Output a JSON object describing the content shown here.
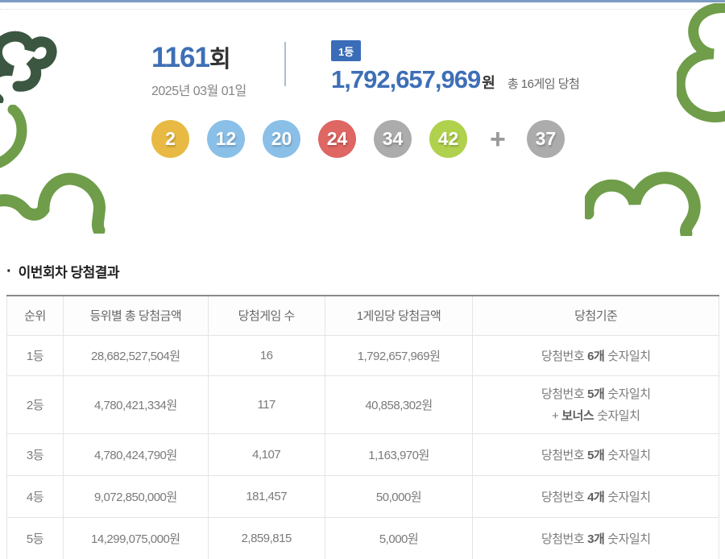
{
  "header": {
    "draw_no": "1161",
    "draw_no_suffix": "회",
    "draw_date": "2025년 03월 01일",
    "rank_badge": "1등",
    "first_prize_amount": "1,792,657,969",
    "won_suffix": "원",
    "total_games": "총 16게임 당첨"
  },
  "balls": {
    "numbers": [
      {
        "value": "2",
        "color": "#e8ba44"
      },
      {
        "value": "12",
        "color": "#8ac0e8"
      },
      {
        "value": "20",
        "color": "#8ac0e8"
      },
      {
        "value": "24",
        "color": "#de6663"
      },
      {
        "value": "34",
        "color": "#acacac"
      },
      {
        "value": "42",
        "color": "#b0d14d"
      }
    ],
    "plus": "+",
    "bonus": {
      "value": "37",
      "color": "#acacac"
    }
  },
  "section": {
    "bullet": "·",
    "title": "이번회차 당첨결과"
  },
  "table": {
    "headers": [
      "순위",
      "등위별 총 당첨금액",
      "당첨게임 수",
      "1게임당 당첨금액",
      "당첨기준"
    ],
    "rows": [
      {
        "rank": "1등",
        "total": "28,682,527,504원",
        "games": "16",
        "per_game": "1,792,657,969원",
        "crit_pre": "당첨번호",
        "crit_bold": "6개",
        "crit_suf": "숫자일치"
      },
      {
        "rank": "2등",
        "total": "4,780,421,334원",
        "games": "117",
        "per_game": "40,858,302원",
        "crit_pre": "당첨번호",
        "crit_bold": "5개",
        "crit_suf": "숫자일치",
        "crit2_pre": "+",
        "crit2_bold": "보너스",
        "crit2_suf": "숫자일치"
      },
      {
        "rank": "3등",
        "total": "4,780,424,790원",
        "games": "4,107",
        "per_game": "1,163,970원",
        "crit_pre": "당첨번호",
        "crit_bold": "5개",
        "crit_suf": "숫자일치"
      },
      {
        "rank": "4등",
        "total": "9,072,850,000원",
        "games": "181,457",
        "per_game": "50,000원",
        "crit_pre": "당첨번호",
        "crit_bold": "4개",
        "crit_suf": "숫자일치"
      },
      {
        "rank": "5등",
        "total": "14,299,075,000원",
        "games": "2,859,815",
        "per_game": "5,000원",
        "crit_pre": "당첨번호",
        "crit_bold": "3개",
        "crit_suf": "숫자일치"
      }
    ]
  },
  "colors": {
    "accent_blue": "#3e6fb6",
    "badge_blue": "#3a6cb8",
    "top_line_blue": "#7d9dc3",
    "doodle_dark_green": "#3b5741",
    "doodle_green": "#6f9d4a"
  }
}
